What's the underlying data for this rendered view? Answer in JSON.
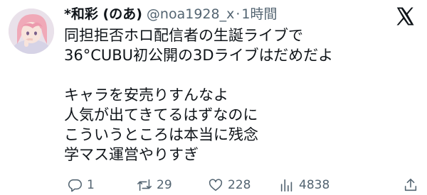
{
  "user": {
    "display_name": "*和彩 (のあ)",
    "handle": "@noa1928_x",
    "separator": "·",
    "time": "1時間"
  },
  "tweet": {
    "lines": [
      "同担拒否ホロ配信者の生誕ライブで",
      "36°CUBU初公開の3Dライブはだめだよ",
      "",
      "キャラを安売りすんなよ",
      "人気が出てきてるはずなのに",
      "こういうところは本当に残念",
      "学マス運営やりすぎ"
    ]
  },
  "actions": {
    "reply_count": "1",
    "retweet_count": "29",
    "like_count": "228",
    "view_count": "4838"
  },
  "icons": {
    "reply": "reply-icon",
    "retweet": "retweet-icon",
    "like": "heart-icon",
    "views": "views-icon",
    "share": "share-icon",
    "logo": "x-logo-icon"
  },
  "colors": {
    "text": "#0f1419",
    "muted": "#536471",
    "background": "#ffffff"
  }
}
